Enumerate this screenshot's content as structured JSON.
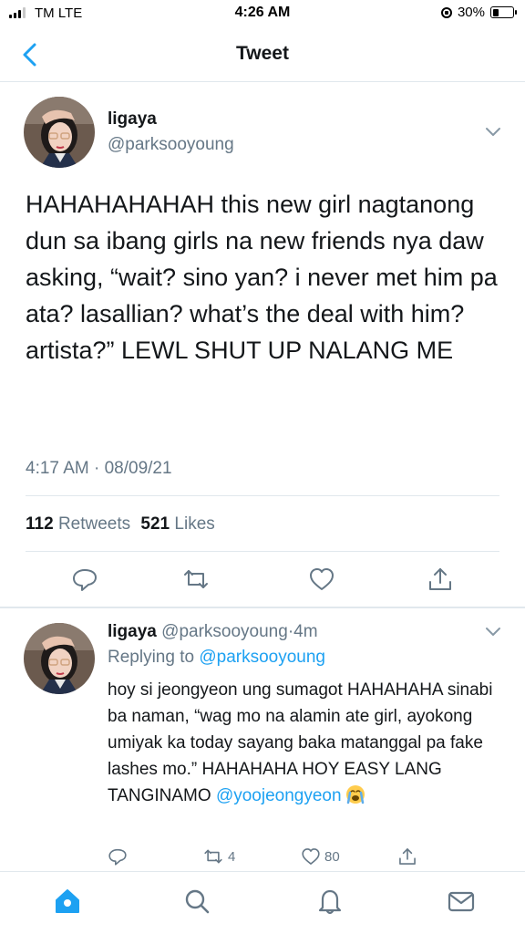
{
  "status_bar": {
    "carrier": "TM  LTE",
    "time": "4:26 AM",
    "battery_percent": "30%",
    "battery_level": 0.3,
    "icons": [
      "signal-icon",
      "orientation-lock-icon",
      "battery-icon"
    ]
  },
  "nav": {
    "title": "Tweet",
    "back_icon": "chevron-left-icon"
  },
  "tweet": {
    "name": "ligaya",
    "handle": "@parksooyoung",
    "text": "HAHAHAHAHAH this new girl nagtanong dun sa ibang girls na new friends nya daw asking, “wait? sino yan? i never met him pa ata? lasallian? what’s the deal with him? artista?” LEWL SHUT UP NALANG ME",
    "timestamp": "4:17 AM · 08/09/21",
    "retweets_count": "112",
    "retweets_label": "Retweets",
    "likes_count": "521",
    "likes_label": "Likes",
    "actions": [
      "reply-icon",
      "retweet-icon",
      "like-icon",
      "share-icon"
    ]
  },
  "reply": {
    "name": "ligaya",
    "handle": "@parksooyoung",
    "separator": "·",
    "age": "4m",
    "replying_prefix": "Replying to",
    "replying_to": "@parksooyoung",
    "text": "hoy si jeongyeon ung sumagot HAHAHAHA sinabi ba naman, “wag mo na alamin ate girl, ayokong umiyak ka today sayang baka matanggal pa fake lashes mo.” HAHAHAHA HOY EASY LANG TANGINAMO",
    "mention": "@yoojeongyeon",
    "emoji": "crying-face",
    "retweets_count": "4",
    "likes_count": "80"
  },
  "tab_bar": {
    "items": [
      "home-icon",
      "search-icon",
      "notifications-icon",
      "messages-icon"
    ]
  },
  "colors": {
    "accent": "#1da1f2",
    "muted": "#657786",
    "text": "#14171a",
    "divider": "#e1e8ed"
  }
}
